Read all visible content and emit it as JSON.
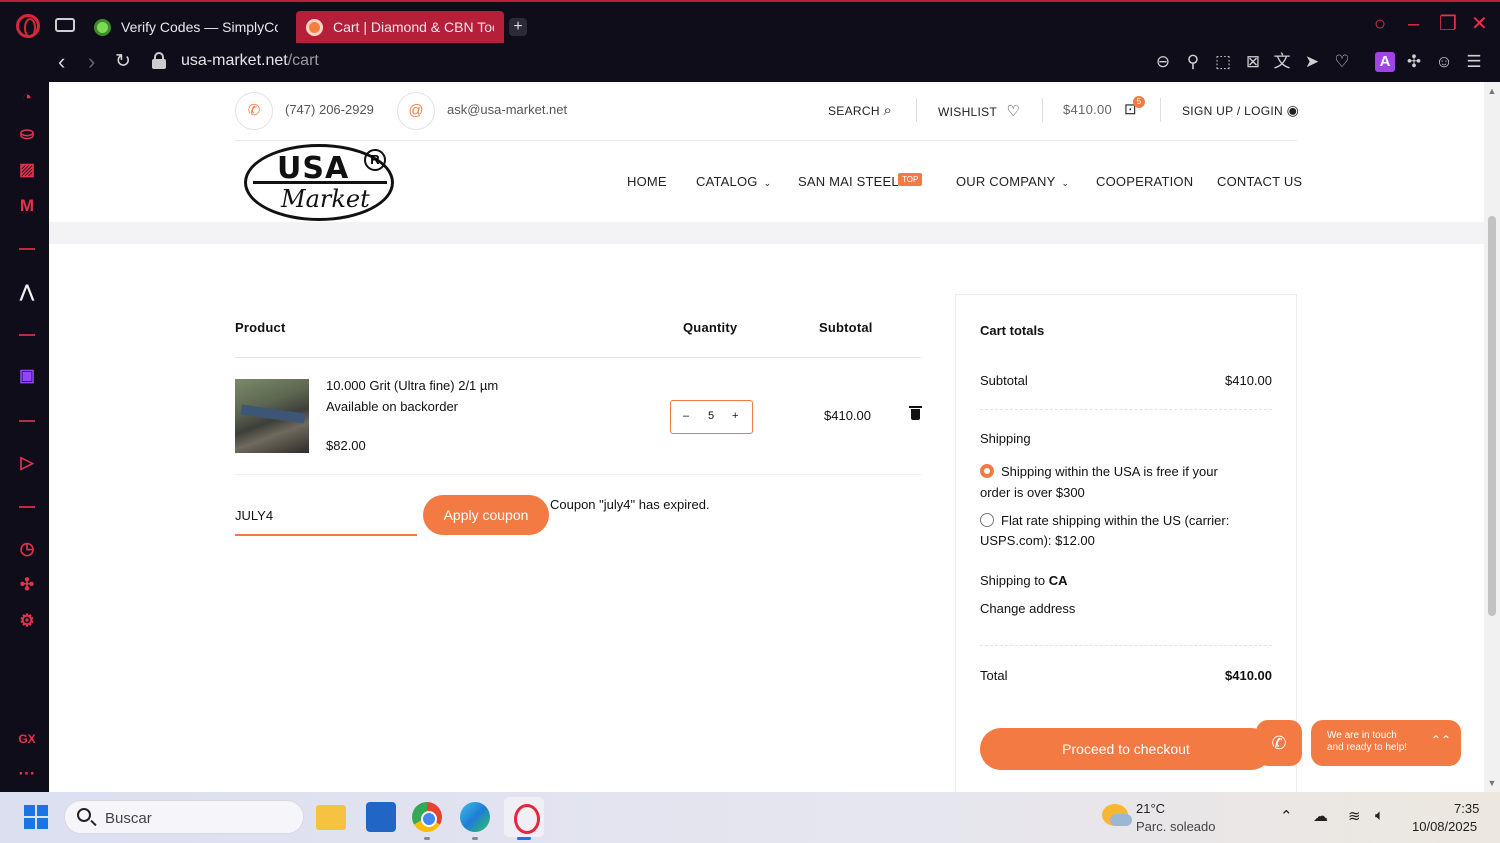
{
  "browser": {
    "tabs": [
      {
        "label": "Verify Codes — SimplyCo"
      },
      {
        "label": "Cart | Diamond & CBN Too"
      }
    ],
    "url_domain": "usa-market.net",
    "url_path": "/cart"
  },
  "site": {
    "phone": "(747) 206-2929",
    "email": "ask@usa-market.net",
    "search_label": "SEARCH",
    "wishlist_label": "WISHLIST",
    "cart_total": "$410.00",
    "cart_count": "5",
    "login_label": "SIGN UP / LOGIN",
    "logo_top": "USA",
    "logo_reg": "R",
    "logo_bottom": "Market",
    "nav": {
      "home": "HOME",
      "catalog": "CATALOG",
      "sanmai": "SAN MAI STEEL",
      "sanmai_badge": "TOP",
      "company": "OUR COMPANY",
      "cooperation": "COOPERATION",
      "contact": "CONTACT US"
    }
  },
  "cart": {
    "headers": {
      "product": "Product",
      "quantity": "Quantity",
      "subtotal": "Subtotal"
    },
    "item": {
      "name": "10.000 Grit (Ultra fine) 2/1 µm",
      "stock": "Available on backorder",
      "price": "$82.00",
      "qty": "5",
      "minus": "–",
      "plus": "+",
      "subtotal": "$410.00"
    },
    "coupon_value": "JULY4",
    "coupon_button": "Apply coupon",
    "coupon_message": "Coupon \"july4\" has expired."
  },
  "totals": {
    "title": "Cart totals",
    "subtotal_label": "Subtotal",
    "subtotal_value": "$410.00",
    "shipping_label": "Shipping",
    "option1_line1": "Shipping within the USA is free if your",
    "option1_line2": "order is over $300",
    "option2_line1": "Flat rate shipping within the US (carrier:",
    "option2_line2": "USPS.com): $12.00",
    "shipping_to_prefix": "Shipping to",
    "shipping_to_state": "CA",
    "change_address": "Change address",
    "total_label": "Total",
    "total_value": "$410.00",
    "checkout_button": "Proceed to checkout"
  },
  "floating": {
    "chat_line1": "We are in touch",
    "chat_line2": "and ready to help!"
  },
  "taskbar": {
    "search_placeholder": "Buscar",
    "temperature": "21°C",
    "weather": "Parc. soleado",
    "time": "7:35",
    "date": "10/08/2025"
  },
  "colors": {
    "accent": "#f47a43",
    "browser_accent": "#e5273c"
  }
}
